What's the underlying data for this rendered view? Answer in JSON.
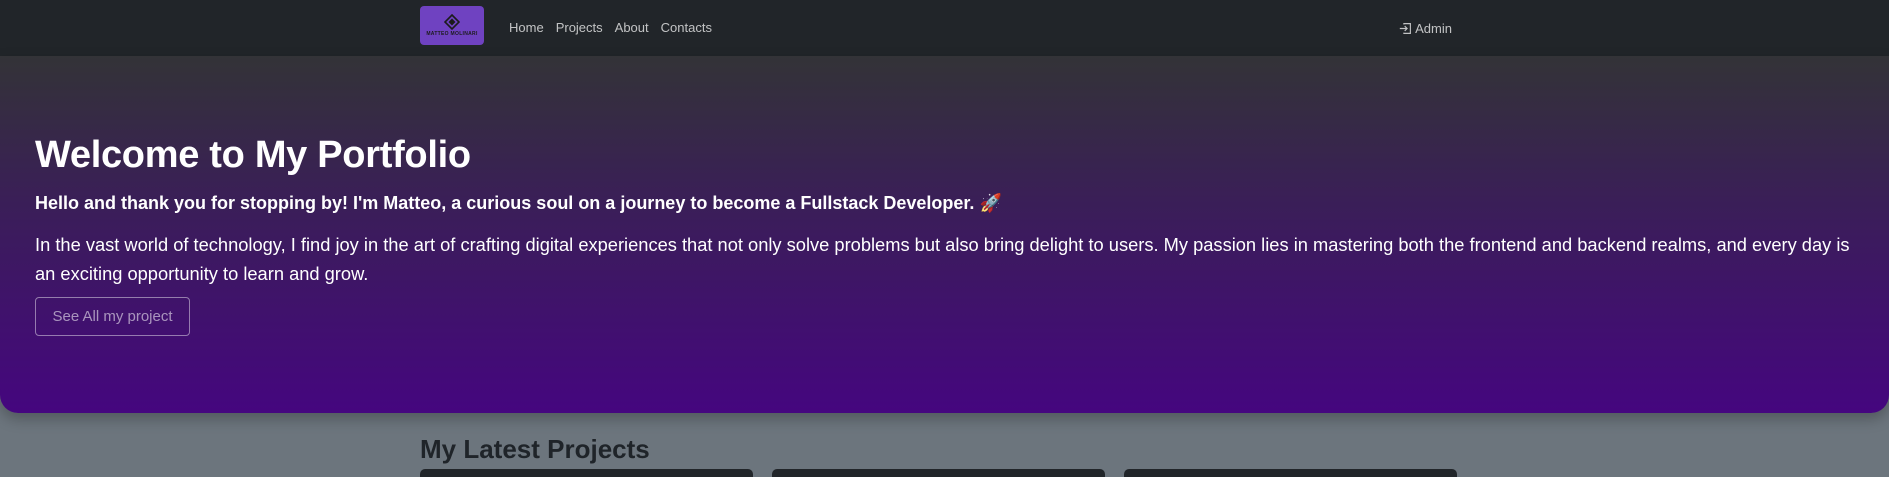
{
  "navbar": {
    "brand_text": "MATTEO MOLINARI",
    "links": [
      {
        "label": "Home"
      },
      {
        "label": "Projects"
      },
      {
        "label": "About"
      },
      {
        "label": "Contacts"
      }
    ],
    "admin_label": "Admin",
    "admin_icon": "login-icon"
  },
  "hero": {
    "title": "Welcome to My Portfolio",
    "lead": "Hello and thank you for stopping by! I'm Matteo, a curious soul on a journey to become a Fullstack Developer. 🚀",
    "paragraph": "In the vast world of technology, I find joy in the art of crafting digital experiences that not only solve problems but also bring delight to users. My passion lies in mastering both the frontend and backend realms, and every day is an exciting opportunity to learn and grow.",
    "button_label": "See All my project"
  },
  "projects": {
    "title": "My Latest Projects",
    "card_count": 3
  },
  "colors": {
    "navbar_bg": "#212529",
    "brand_bg": "#6f42c1",
    "hero_gradient_top": "#333337",
    "hero_gradient_bottom": "#45067f",
    "page_bg": "#6c757d"
  }
}
